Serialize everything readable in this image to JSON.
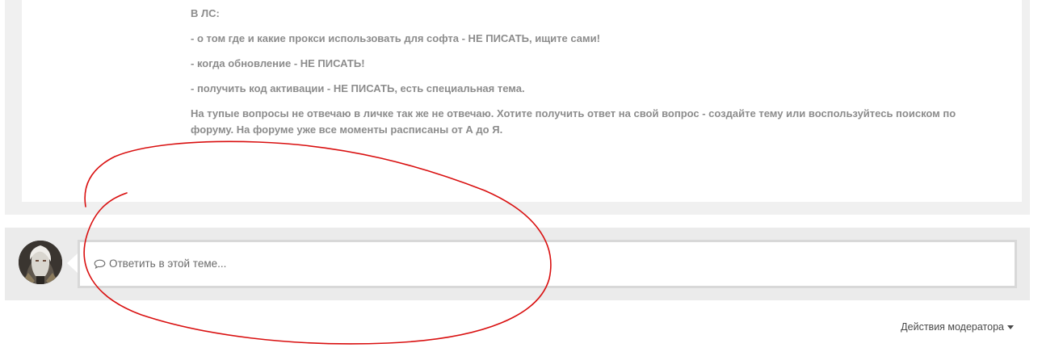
{
  "post": {
    "heading": "В ЛС:",
    "rules": [
      "- о том где и какие прокси использовать для софта - НЕ ПИСАТЬ, ищите сами!",
      "- когда обновление  - НЕ ПИСАТЬ!",
      "- получить код активации - НЕ ПИСАТЬ, есть специальная тема."
    ],
    "closing": "На тупые вопросы не отвечаю в личке так же не отвечаю. Хотите получить ответ на свой вопрос - создайте тему или воспользуйтесь поиском по форуму. На форуме уже все моменты расписаны от А до Я."
  },
  "reply": {
    "placeholder": "Ответить в этой теме...",
    "icon": "comment-icon"
  },
  "moderator": {
    "label": "Действия модератора",
    "icon": "caret-down-icon"
  },
  "colors": {
    "annotation": "#d90f0f",
    "post_text": "#8c8c8c",
    "frame": "#f0f0f0",
    "reply_bar": "#ebebeb"
  }
}
